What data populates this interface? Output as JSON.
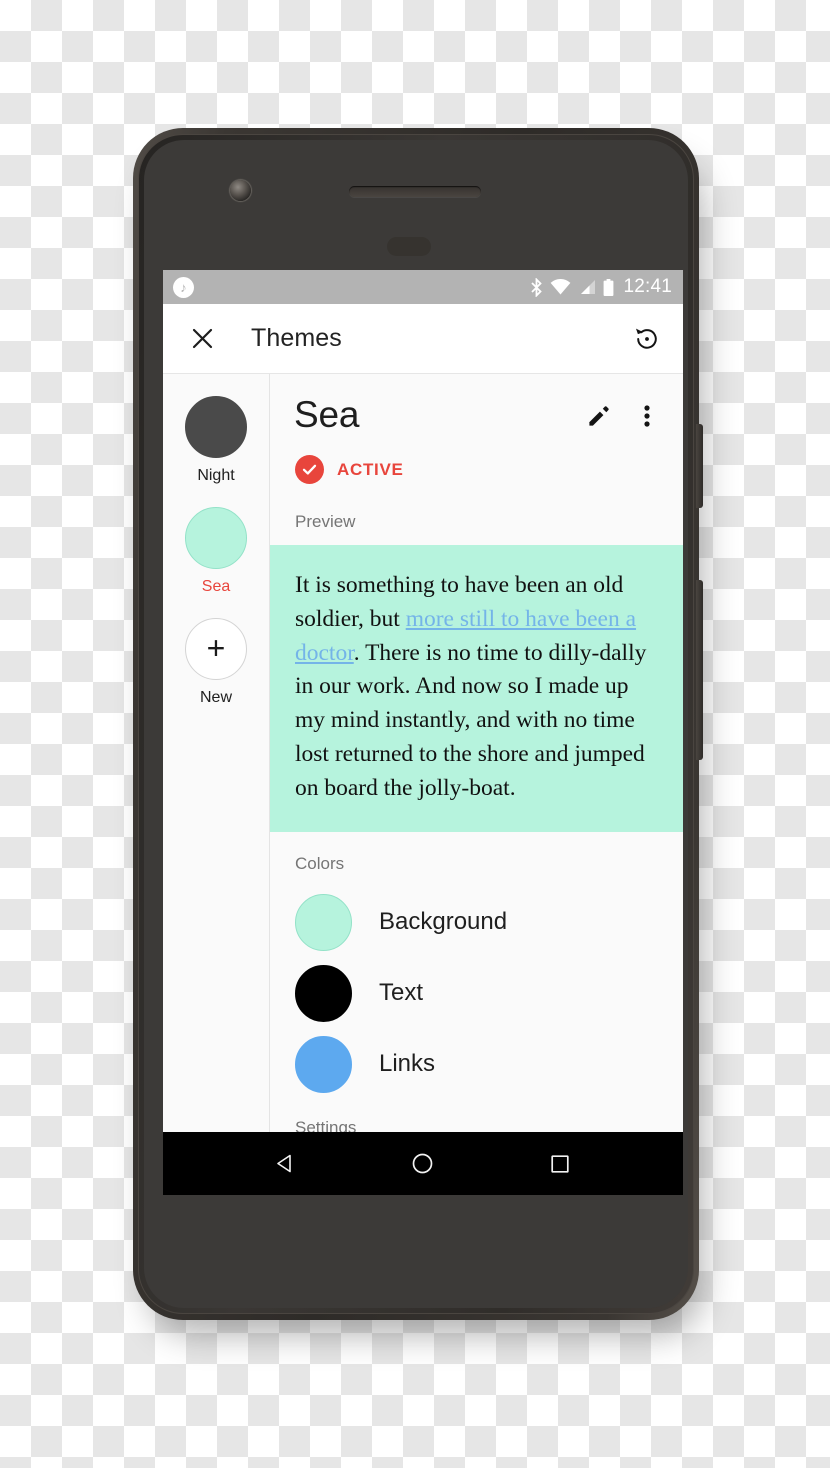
{
  "device": {
    "name": "android-smartphone-mockup",
    "camera_icon": "front-camera-icon",
    "earpiece_icon": "earpiece-speaker-icon",
    "sensor_icon": "proximity-sensor-icon",
    "power_key": "power-button",
    "volume_key": "volume-rocker"
  },
  "statusbar": {
    "notification_icon": "music-note-icon",
    "notification_glyph": "♪",
    "bluetooth_icon": "bluetooth-icon",
    "wifi_icon": "wifi-icon",
    "signal_icon": "cellular-signal-icon",
    "battery_icon": "battery-icon",
    "time": "12:41",
    "background": "#b3b3b3"
  },
  "appbar": {
    "close_icon": "close-icon",
    "title": "Themes",
    "restore_icon": "restore-history-icon"
  },
  "sidebar": {
    "items": [
      {
        "label": "Night",
        "color": "#4a4a4a",
        "border": "#4a4a4a",
        "selected": false,
        "is_new": false
      },
      {
        "label": "Sea",
        "color": "#b6f3dd",
        "border": "#93e2c8",
        "selected": true,
        "is_new": false
      },
      {
        "label": "New",
        "color": "#ffffff",
        "border": "#d4d4d4",
        "selected": false,
        "is_new": true,
        "plus_glyph": "+"
      }
    ],
    "selected_color": "#e8453c"
  },
  "detail": {
    "title": "Sea",
    "edit_icon": "edit-pencil-icon",
    "overflow_icon": "more-vertical-icon",
    "status_badge": {
      "label": "ACTIVE",
      "color": "#e8453c",
      "check_icon": "check-icon"
    },
    "preview_label": "Preview",
    "preview": {
      "text_before": "It is something to have been an old soldier, but ",
      "link_text": "more still to have been a doctor",
      "text_after": ". There is no time to dilly-dally in our work. And now so I made up my mind instantly, and with no time lost returned to the shore and jumped on board the jolly-boat.",
      "background": "#b6f3dd",
      "text_color": "#111111",
      "link_color": "#74b4e8"
    },
    "colors_label": "Colors",
    "colors": [
      {
        "name": "Background",
        "value": "#b6f3dd",
        "border": "#93e2c8"
      },
      {
        "name": "Text",
        "value": "#000000",
        "border": "#000000"
      },
      {
        "name": "Links",
        "value": "#5da9ef",
        "border": "#5da9ef"
      }
    ],
    "settings_label": "Settings"
  },
  "navbar": {
    "back_icon": "back-triangle-icon",
    "home_icon": "home-circle-icon",
    "recents_icon": "recents-square-icon"
  }
}
